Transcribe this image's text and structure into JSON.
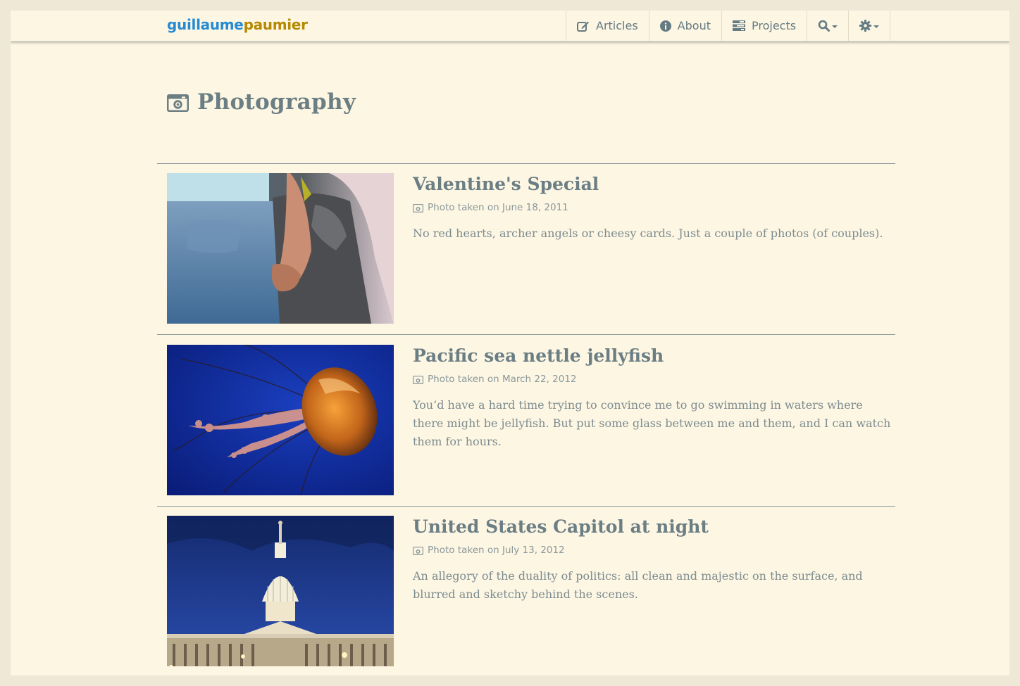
{
  "brand": {
    "part1": "guillaume",
    "part2": "paumier"
  },
  "nav": {
    "articles": "Articles",
    "about": "About",
    "projects": "Projects",
    "search_icon": "search-icon",
    "settings_icon": "gear-icon"
  },
  "page": {
    "title": "Photography",
    "title_icon": "camera-icon"
  },
  "entries": [
    {
      "title": "Valentine's Special",
      "meta": "Photo taken on June 18, 2011",
      "description": "No red hearts, archer angels or cheesy cards. Just a couple of photos (of couples)."
    },
    {
      "title": "Pacific sea nettle jellyfish",
      "meta": "Photo taken on March 22, 2012",
      "description": "You’d have a hard time trying to convince me to go swimming in waters where there might be jellyfish. But put some glass between me and them, and I can watch them for hours."
    },
    {
      "title": "United States Capitol at night",
      "meta": "Photo taken on July 13, 2012",
      "description": "An allegory of the duality of politics: all clean and majestic on the surface, and blurred and sketchy behind the scenes."
    }
  ],
  "colors": {
    "background": "#fdf6e3",
    "brand_blue": "#268bd2",
    "brand_gold": "#b58900",
    "text": "#657b83"
  }
}
